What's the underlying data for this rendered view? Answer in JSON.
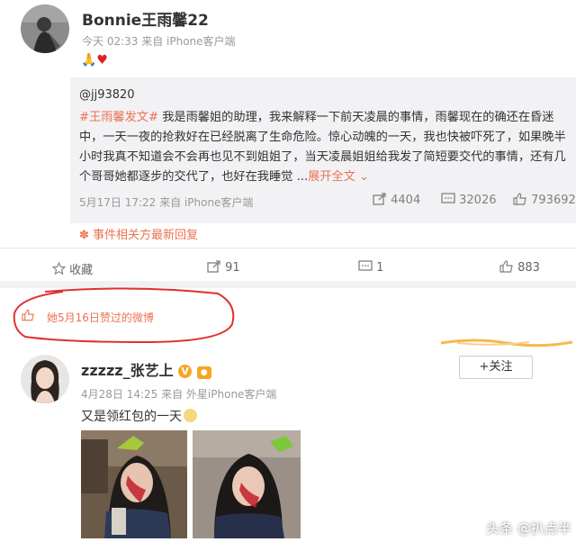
{
  "post1": {
    "username": "Bonnie王雨馨22",
    "meta": "今天 02:33 来自 iPhone客户端",
    "emoji": "🙏♥",
    "retweet": {
      "user": "@jj93820",
      "hashtag": "#王雨馨发文#",
      "text": " 我是雨馨姐的助理，我来解释一下前天凌晨的事情，雨馨现在的确还在昏迷中，一天一夜的抢救好在已经脱离了生命危险。惊心动魄的一天，我也快被吓死了，如果晚半小时我真不知道会不会再也见不到姐姐了，当天凌晨姐姐给我发了简短要交代的事情，还有几个哥哥她都逐步的交代了，也好在我睡觉 ...",
      "expand": "展开全文",
      "date": "5月17日 17:22 来自 iPhone客户端",
      "stats": {
        "repost": "4404",
        "comment": "32026",
        "like": "793692"
      },
      "event_label": "事件相关方最新回复"
    },
    "actions": {
      "favorite": "收藏",
      "repost": "91",
      "comment": "1",
      "like": "883"
    }
  },
  "liked_note": "她5月16日赞过的微博",
  "post2": {
    "username": "zzzzz_张艺上",
    "meta": "4月28日 14:25 来自 外星iPhone客户端",
    "text": "又是领红包的一天",
    "follow_label": "+关注"
  },
  "watermark": "头条 @扒点半",
  "colors": {
    "accent": "#eb7350",
    "annotation": "#e0302f",
    "muted": "#999999"
  }
}
